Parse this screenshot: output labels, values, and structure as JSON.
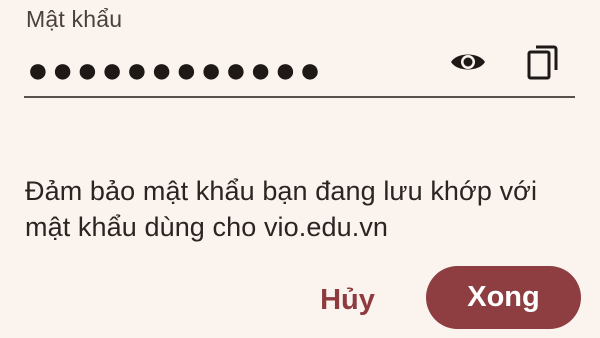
{
  "password_field": {
    "label": "Mật khẩu",
    "masked_value": "●●●●●●●●●●●●",
    "show_icon": "eye-icon",
    "copy_icon": "copy-icon"
  },
  "message": "Đảm bảo mật khẩu bạn đang lưu khớp với mật khẩu dùng cho vio.edu.vn",
  "actions": {
    "cancel_label": "Hủy",
    "done_label": "Xong"
  },
  "colors": {
    "background": "#fbf3ee",
    "accent": "#8e3d41",
    "text": "#2c2422"
  }
}
